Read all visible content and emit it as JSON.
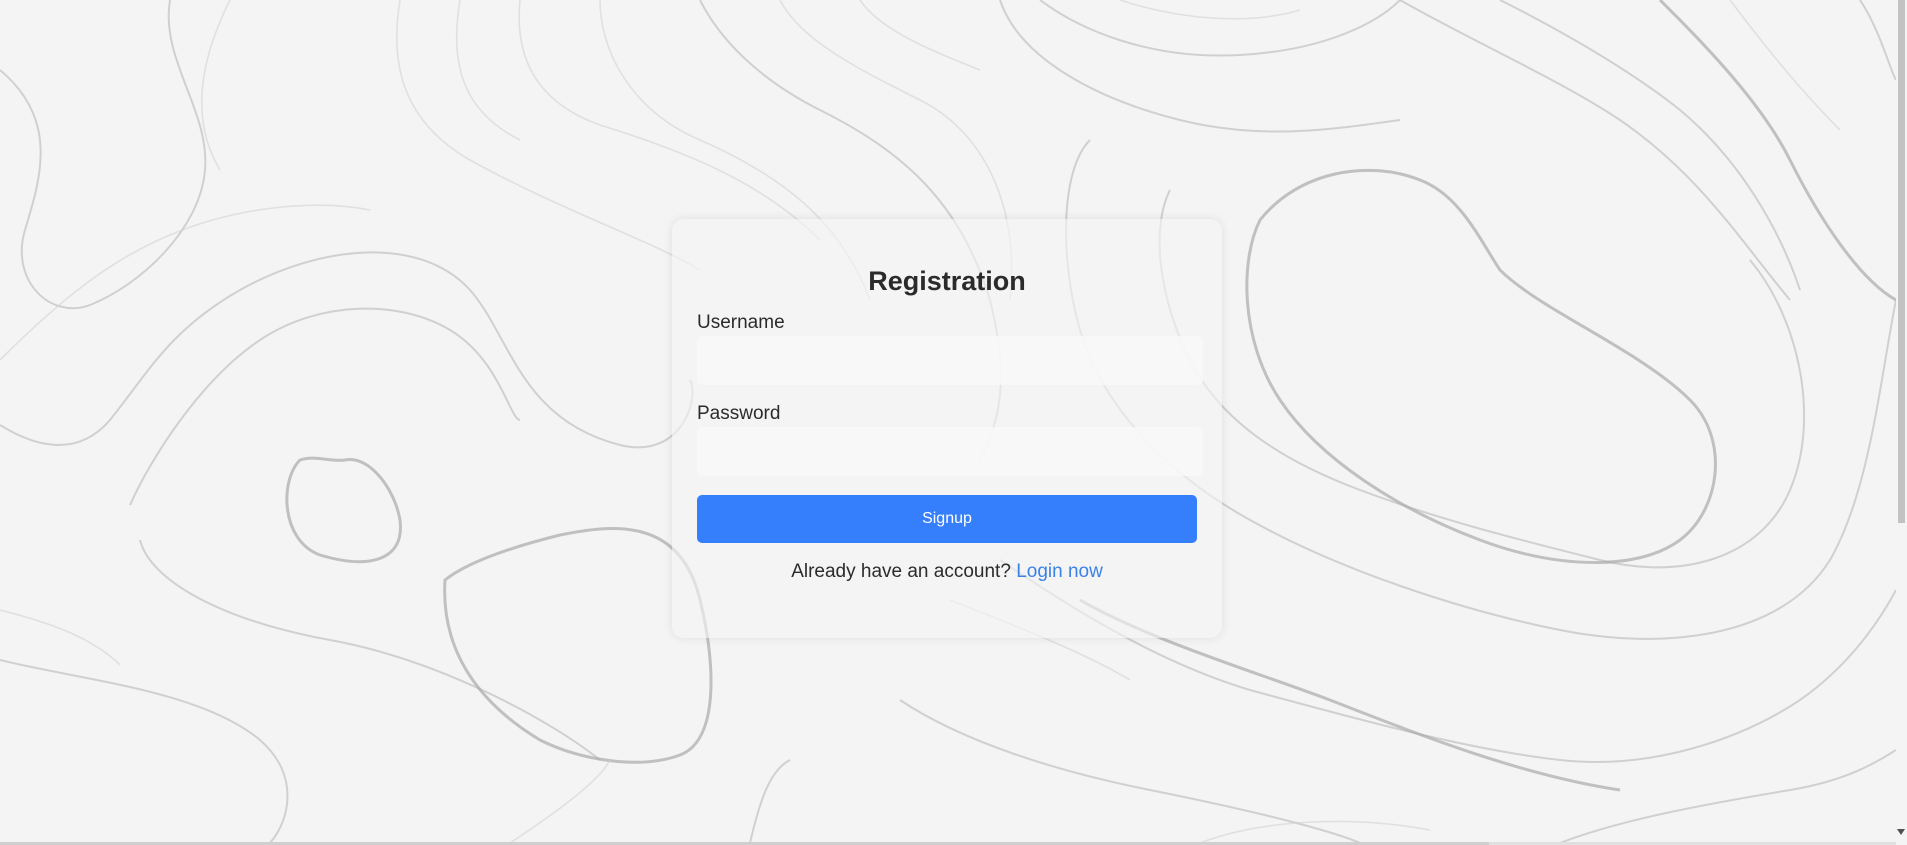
{
  "form": {
    "title": "Registration",
    "username_label": "Username",
    "username_value": "",
    "password_label": "Password",
    "password_value": "",
    "signup_label": "Signup",
    "footer_text": "Already have an account?",
    "login_link": "Login now"
  },
  "colors": {
    "background": "#f4f4f4",
    "primary_button": "#367ffc",
    "link": "#3b82e6",
    "text": "#2b2b2b"
  }
}
